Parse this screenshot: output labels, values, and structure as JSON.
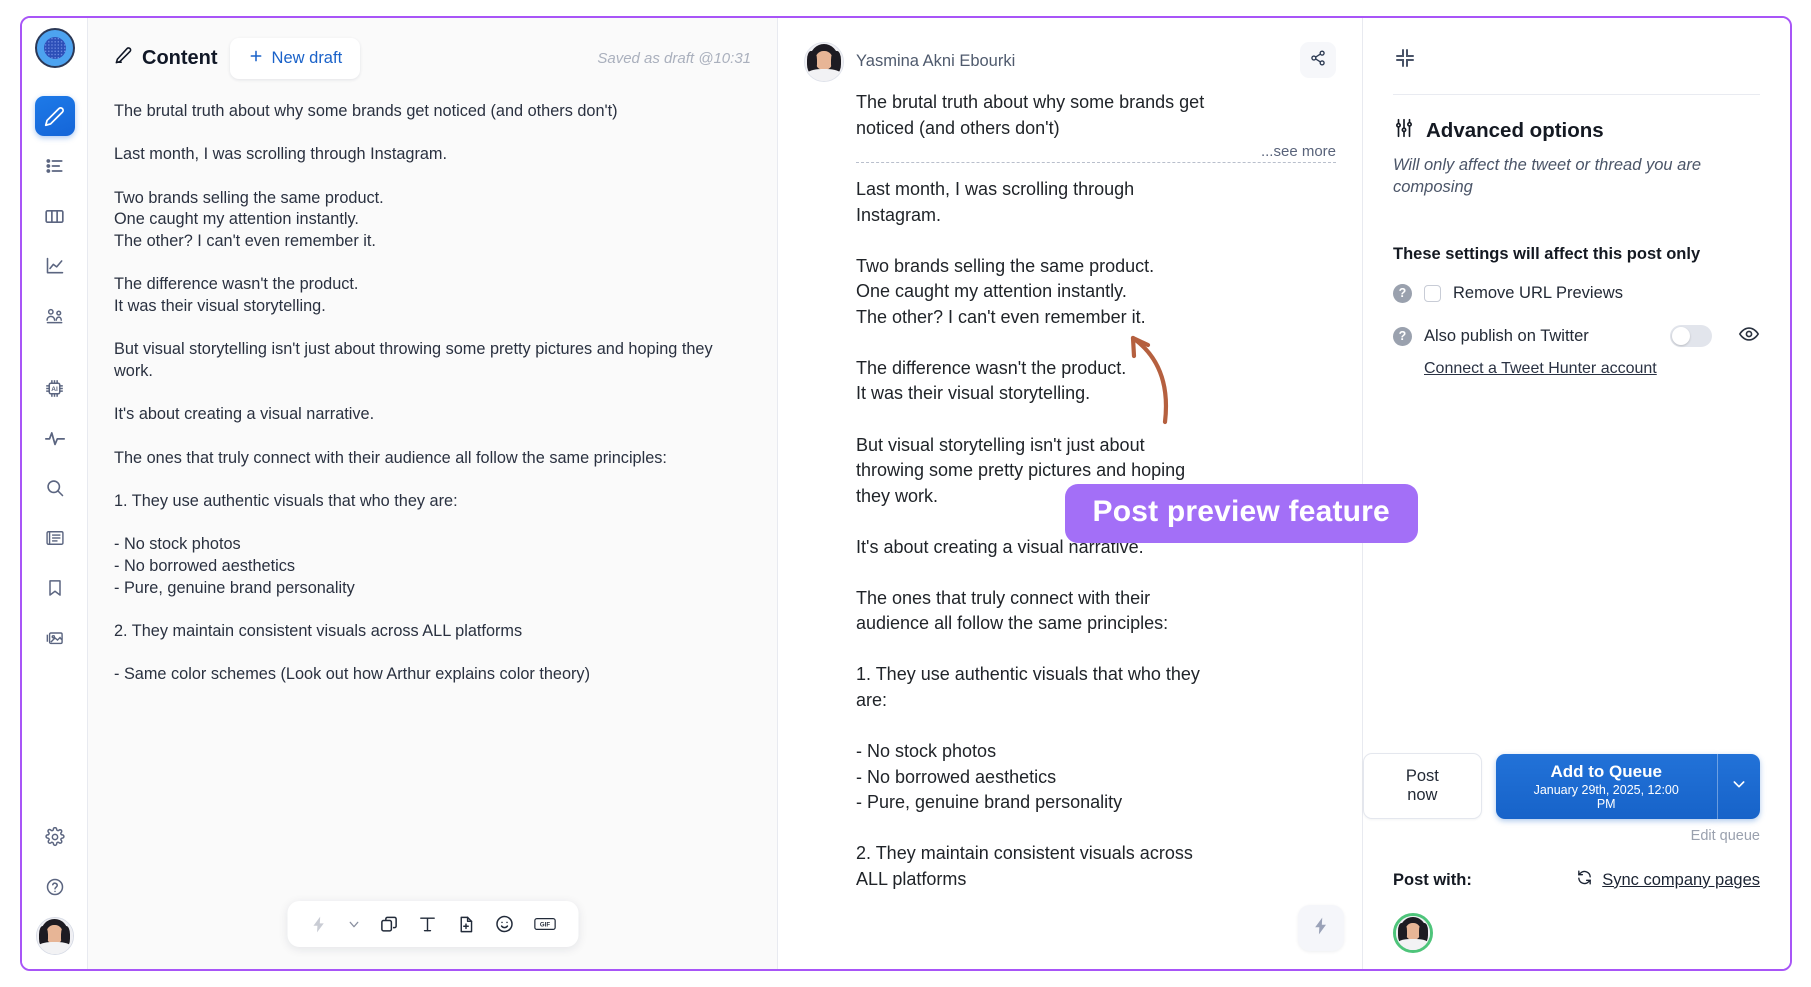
{
  "rail": {
    "logo_name": "app-logo",
    "items": [
      {
        "name": "compose",
        "icon": "pencil-icon",
        "active": true
      },
      {
        "name": "queue-list",
        "icon": "list-icon",
        "active": false
      },
      {
        "name": "columns",
        "icon": "columns-icon",
        "active": false
      },
      {
        "name": "analytics",
        "icon": "chart-line-icon",
        "active": false
      },
      {
        "name": "audience",
        "icon": "people-gear-icon",
        "active": false
      },
      {
        "name": "ai",
        "icon": "ai-chip-icon",
        "active": false
      },
      {
        "name": "activity",
        "icon": "pulse-icon",
        "active": false
      },
      {
        "name": "search",
        "icon": "search-icon",
        "active": false
      },
      {
        "name": "feed",
        "icon": "newspaper-icon",
        "active": false
      },
      {
        "name": "bookmarks",
        "icon": "bookmark-icon",
        "active": false
      },
      {
        "name": "media",
        "icon": "image-icon",
        "active": false
      },
      {
        "name": "settings",
        "icon": "gear-icon",
        "active": false
      },
      {
        "name": "help",
        "icon": "question-circle-icon",
        "active": false
      }
    ]
  },
  "editor": {
    "title": "Content",
    "title_icon": "pencil-edit-icon",
    "new_draft_label": "New draft",
    "new_draft_icon": "plus-icon",
    "saved_status": "Saved as draft @10:31",
    "content": "The brutal truth about why some brands get noticed (and others don't)\n\nLast month, I was scrolling through Instagram.\n\nTwo brands selling the same product.\nOne caught my attention instantly.\nThe other? I can't even remember it.\n\nThe difference wasn't the product.\nIt was their visual storytelling.\n\nBut visual storytelling isn't just about throwing some pretty pictures and hoping they work.\n\nIt's about creating a visual narrative.\n\nThe ones that truly connect with their audience all follow the same principles:\n\n1. They use authentic visuals that who they are:\n\n- No stock photos\n- No borrowed aesthetics\n- Pure, genuine brand personality\n\n2. They maintain consistent visuals across ALL platforms\n\n- Same color schemes (Look out how Arthur explains color theory)",
    "toolbar": [
      {
        "name": "ai-lightning-button",
        "icon": "lightning-icon"
      },
      {
        "name": "ai-dropdown-button",
        "icon": "chevron-down-icon"
      },
      {
        "name": "duplicate-button",
        "icon": "copy-icon"
      },
      {
        "name": "text-format-button",
        "icon": "text-T-icon"
      },
      {
        "name": "add-file-button",
        "icon": "file-plus-icon"
      },
      {
        "name": "emoji-button",
        "icon": "smiley-icon"
      },
      {
        "name": "gif-button",
        "icon": "gif-icon"
      }
    ]
  },
  "preview": {
    "author": "Yasmina Akni Ebourki",
    "share_icon": "share-icon",
    "headline": "The brutal truth about why some brands get\nnoticed (and others don't)",
    "see_more": "...see more",
    "body": "Last month, I was scrolling through\nInstagram.\n\nTwo brands selling the same product.\nOne caught my attention instantly.\nThe other? I can't even remember it.\n\nThe difference wasn't the product.\nIt was their visual storytelling.\n\nBut visual storytelling isn't just about\nthrowing some pretty pictures and hoping\nthey work.\n\nIt's about creating a visual narrative.\n\nThe ones that truly connect with their\naudience all follow the same principles:\n\n1. They use authentic visuals that who they\nare:\n\n- No stock photos\n- No borrowed aesthetics\n- Pure, genuine brand personality\n\n2. They maintain consistent visuals across\nALL platforms",
    "bolt_icon": "lightning-icon"
  },
  "options": {
    "collapse_icon": "collapse-icon",
    "title": "Advanced options",
    "title_icon": "sliders-icon",
    "subtitle": "Will only affect the tweet or thread you are composing",
    "affect_note": "These settings will affect this post only",
    "rows": [
      {
        "name": "remove-url-previews",
        "label": "Remove URL Previews",
        "help_icon": "question-icon",
        "control": "checkbox",
        "checked": false
      },
      {
        "name": "also-publish-on-twitter",
        "label": "Also publish on Twitter",
        "help_icon": "question-icon",
        "control": "toggle",
        "enabled": false,
        "eye_icon": "eye-icon"
      }
    ],
    "connect_link": "Connect a Tweet Hunter account",
    "post_now_label": "Post now",
    "queue_label": "Add to Queue",
    "queue_time": "January 29th, 2025, 12:00 PM",
    "queue_caret_icon": "chevron-down-icon",
    "edit_queue_label": "Edit queue",
    "post_with_label": "Post with:",
    "sync_label": "Sync company pages",
    "sync_icon": "refresh-icon"
  },
  "annotation": {
    "callout_text": "Post preview feature",
    "callout_color": "#a36ff7",
    "arrow_color": "#b5603f"
  }
}
